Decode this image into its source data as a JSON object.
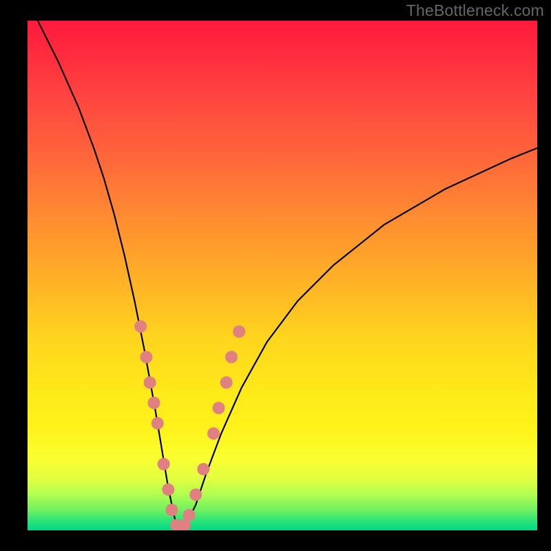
{
  "watermark": "TheBottleneck.com",
  "chart_data": {
    "type": "line",
    "title": "",
    "xlabel": "",
    "ylabel": "",
    "xlim": [
      0,
      100
    ],
    "ylim": [
      0,
      100
    ],
    "legend": false,
    "grid": false,
    "series": [
      {
        "name": "bottleneck-curve",
        "x": [
          2,
          6,
          10,
          13,
          15,
          17,
          19,
          21,
          23,
          25,
          26.5,
          27.5,
          28.5,
          29.2,
          30,
          31,
          33,
          35,
          38,
          42,
          47,
          53,
          60,
          70,
          82,
          95,
          100
        ],
        "y": [
          100,
          92,
          83,
          75,
          69,
          62,
          54,
          45,
          35,
          24,
          15,
          9,
          4,
          1,
          0.5,
          1,
          5,
          11,
          19,
          28,
          37,
          45,
          52,
          60,
          67,
          73,
          75
        ]
      }
    ],
    "markers": {
      "name": "sample-points",
      "points": [
        {
          "x": 22.2,
          "y": 40
        },
        {
          "x": 23.3,
          "y": 34
        },
        {
          "x": 24.0,
          "y": 29
        },
        {
          "x": 24.8,
          "y": 25
        },
        {
          "x": 25.5,
          "y": 21
        },
        {
          "x": 26.7,
          "y": 13
        },
        {
          "x": 27.6,
          "y": 8
        },
        {
          "x": 28.3,
          "y": 4
        },
        {
          "x": 29.2,
          "y": 1
        },
        {
          "x": 30.0,
          "y": 0.5
        },
        {
          "x": 30.8,
          "y": 1
        },
        {
          "x": 31.7,
          "y": 3
        },
        {
          "x": 33.0,
          "y": 7
        },
        {
          "x": 34.5,
          "y": 12
        },
        {
          "x": 36.5,
          "y": 19
        },
        {
          "x": 37.5,
          "y": 24
        },
        {
          "x": 39.0,
          "y": 29
        },
        {
          "x": 40.0,
          "y": 34
        },
        {
          "x": 41.5,
          "y": 39
        }
      ]
    },
    "background": "vertical-gradient-red-to-green"
  }
}
